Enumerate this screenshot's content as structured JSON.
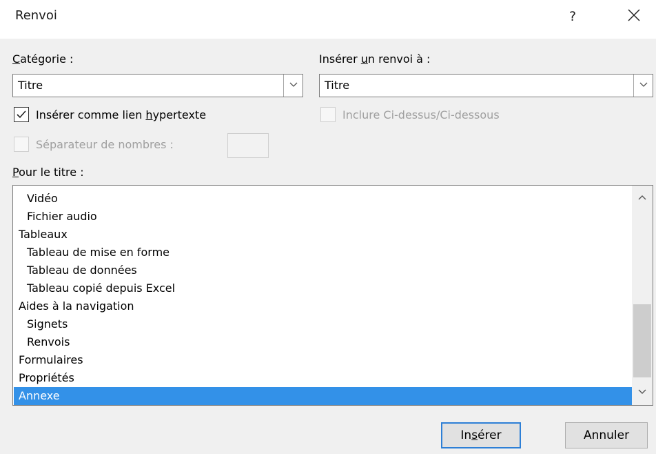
{
  "dialog": {
    "title": "Renvoi",
    "help_label": "?",
    "close_icon": "close-icon"
  },
  "category": {
    "label_pre": "",
    "label_accel": "C",
    "label_post": "atégorie :",
    "value": "Titre"
  },
  "insert_ref": {
    "label_pre": "Insérer ",
    "label_accel": "u",
    "label_post": "n renvoi à :",
    "value": "Titre"
  },
  "hyperlink_check": {
    "label_pre": "Insérer comme lien ",
    "label_accel": "h",
    "label_post": "ypertexte",
    "checked": true
  },
  "above_below_check": {
    "label": "Inclure Ci-dessus/Ci-dessous",
    "checked": false,
    "disabled": true
  },
  "separator_check": {
    "label": "Séparateur de nombres :",
    "checked": false,
    "disabled": true,
    "value": ""
  },
  "for_title": {
    "label_pre": "",
    "label_accel": "P",
    "label_post": "our le titre :"
  },
  "list": {
    "items": [
      {
        "text": "Vidéo",
        "level": 2
      },
      {
        "text": "Fichier audio",
        "level": 2
      },
      {
        "text": "Tableaux",
        "level": 1
      },
      {
        "text": "Tableau de mise en forme",
        "level": 2
      },
      {
        "text": "Tableau de données",
        "level": 2
      },
      {
        "text": "Tableau copié depuis Excel",
        "level": 2
      },
      {
        "text": "Aides à la navigation",
        "level": 1
      },
      {
        "text": "Signets",
        "level": 2
      },
      {
        "text": "Renvois",
        "level": 2
      },
      {
        "text": "Formulaires",
        "level": 1
      },
      {
        "text": "Propriétés",
        "level": 1
      },
      {
        "text": "Annexe",
        "level": 1,
        "selected": true
      }
    ],
    "selected_color": "#3391e8"
  },
  "buttons": {
    "insert_pre": "In",
    "insert_accel": "s",
    "insert_post": "érer",
    "cancel": "Annuler"
  },
  "colors": {
    "accent": "#2d7fd6",
    "dialog_bg": "#f0f0f0"
  }
}
